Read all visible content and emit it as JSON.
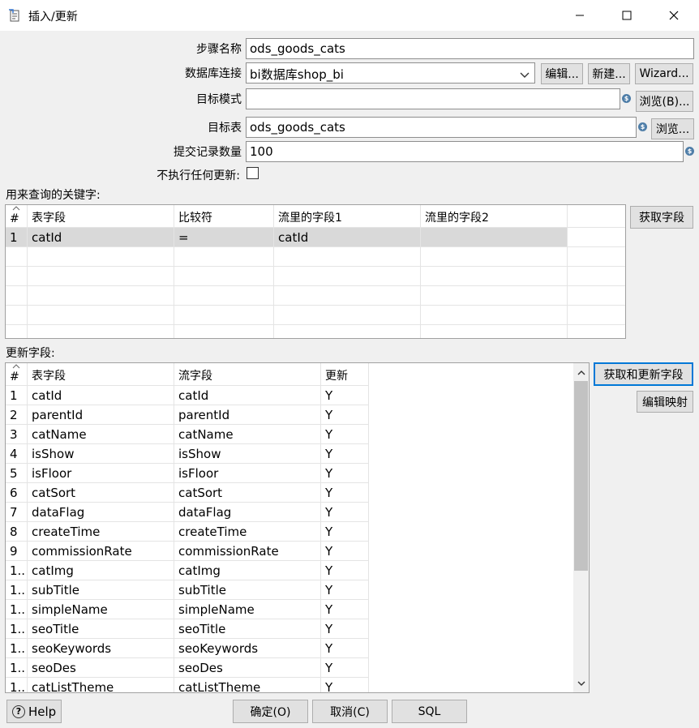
{
  "window": {
    "title": "插入/更新",
    "minimize_icon": "minimize-icon",
    "maximize_icon": "maximize-icon",
    "close_icon": "close-icon"
  },
  "form": {
    "step_name_label": "步骤名称",
    "step_name_value": "ods_goods_cats",
    "db_conn_label": "数据库连接",
    "db_conn_value": "bi数据库shop_bi",
    "edit_label": "编辑...",
    "new_label": "新建...",
    "wizard_label": "Wizard...",
    "target_schema_label": "目标模式",
    "target_schema_value": "",
    "browse_b_label": "浏览(B)...",
    "target_table_label": "目标表",
    "target_table_value": "ods_goods_cats",
    "browse_label": "浏览...",
    "commit_size_label": "提交记录数量",
    "commit_size_value": "100",
    "no_update_label": "不执行任何更新:",
    "no_update_checked": false
  },
  "key_section": {
    "label": "用来查询的关键字:",
    "get_fields_label": "获取字段",
    "columns": [
      "#",
      "表字段",
      "比较符",
      "流里的字段1",
      "流里的字段2"
    ],
    "rows": [
      {
        "num": "1",
        "table_field": "catId",
        "comparator": "=",
        "stream_field1": "catId",
        "stream_field2": ""
      }
    ]
  },
  "update_section": {
    "label": "更新字段:",
    "get_update_fields_label": "获取和更新字段",
    "edit_mapping_label": "编辑映射",
    "columns": [
      "#",
      "表字段",
      "流字段",
      "更新"
    ],
    "rows": [
      {
        "num": "1",
        "table_field": "catId",
        "stream_field": "catId",
        "update": "Y"
      },
      {
        "num": "2",
        "table_field": "parentId",
        "stream_field": "parentId",
        "update": "Y"
      },
      {
        "num": "3",
        "table_field": "catName",
        "stream_field": "catName",
        "update": "Y"
      },
      {
        "num": "4",
        "table_field": "isShow",
        "stream_field": "isShow",
        "update": "Y"
      },
      {
        "num": "5",
        "table_field": "isFloor",
        "stream_field": "isFloor",
        "update": "Y"
      },
      {
        "num": "6",
        "table_field": "catSort",
        "stream_field": "catSort",
        "update": "Y"
      },
      {
        "num": "7",
        "table_field": "dataFlag",
        "stream_field": "dataFlag",
        "update": "Y"
      },
      {
        "num": "8",
        "table_field": "createTime",
        "stream_field": "createTime",
        "update": "Y"
      },
      {
        "num": "9",
        "table_field": "commissionRate",
        "stream_field": "commissionRate",
        "update": "Y"
      },
      {
        "num": "1..",
        "table_field": "catImg",
        "stream_field": "catImg",
        "update": "Y"
      },
      {
        "num": "1..",
        "table_field": "subTitle",
        "stream_field": "subTitle",
        "update": "Y"
      },
      {
        "num": "1..",
        "table_field": "simpleName",
        "stream_field": "simpleName",
        "update": "Y"
      },
      {
        "num": "1..",
        "table_field": "seoTitle",
        "stream_field": "seoTitle",
        "update": "Y"
      },
      {
        "num": "1..",
        "table_field": "seoKeywords",
        "stream_field": "seoKeywords",
        "update": "Y"
      },
      {
        "num": "1..",
        "table_field": "seoDes",
        "stream_field": "seoDes",
        "update": "Y"
      },
      {
        "num": "1..",
        "table_field": "catListTheme",
        "stream_field": "catListTheme",
        "update": "Y"
      }
    ]
  },
  "footer": {
    "help_label": "Help",
    "ok_label": "确定(O)",
    "cancel_label": "取消(C)",
    "sql_label": "SQL"
  },
  "colors": {
    "accent": "#0078d7",
    "selected_row": "#d9d9d9",
    "variable_icon": "#4f7ea8"
  }
}
